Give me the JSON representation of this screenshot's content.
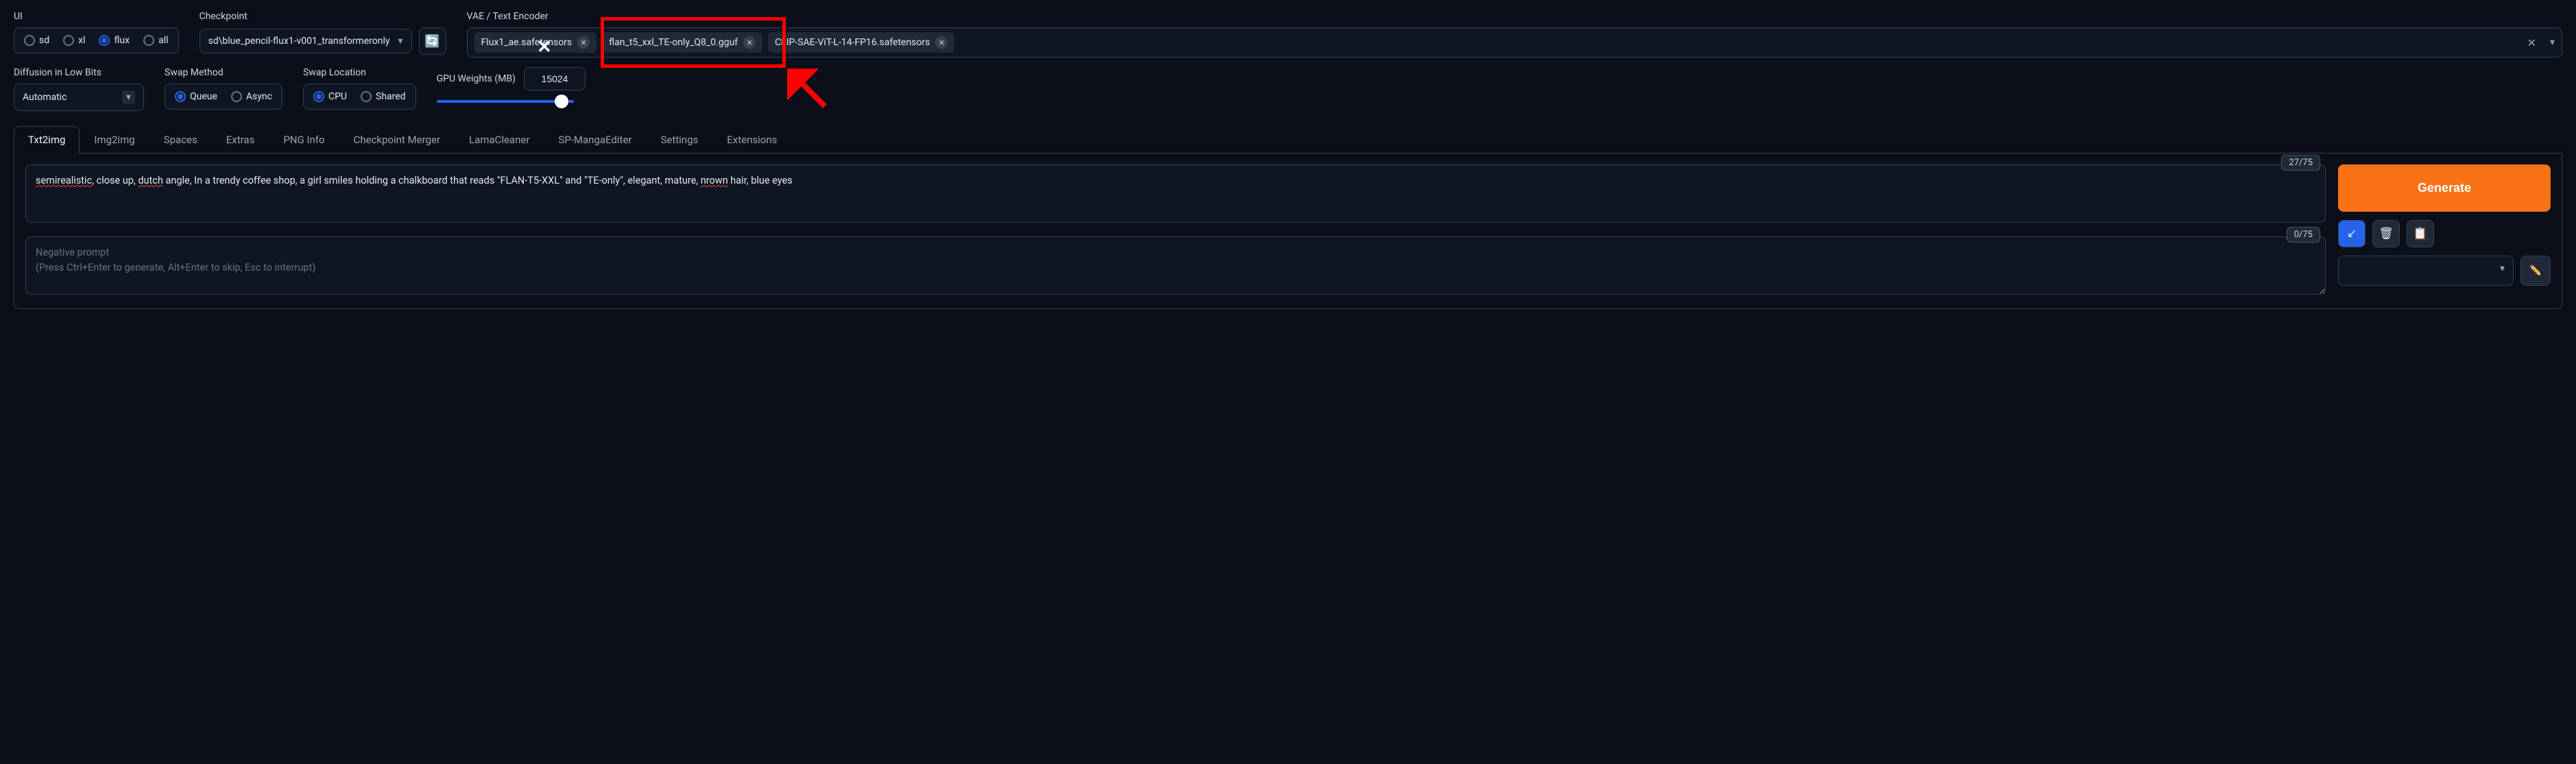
{
  "labels": {
    "ui": "UI",
    "checkpoint": "Checkpoint",
    "vae": "VAE / Text Encoder",
    "diffusion": "Diffusion in Low Bits",
    "swap_method": "Swap Method",
    "swap_location": "Swap Location",
    "gpu_weights": "GPU Weights (MB)"
  },
  "ui_options": [
    {
      "label": "sd",
      "checked": false
    },
    {
      "label": "xl",
      "checked": false
    },
    {
      "label": "flux",
      "checked": true
    },
    {
      "label": "all",
      "checked": false
    }
  ],
  "checkpoint": "sd\\blue_pencil-flux1-v001_transformeronly",
  "vae_tags": [
    "Flux1_ae.safetensors",
    "flan_t5_xxl_TE-only_Q8_0.gguf",
    "CLIP-SAE-ViT-L-14-FP16.safetensors"
  ],
  "diffusion_value": "Automatic",
  "swap_method": [
    {
      "label": "Queue",
      "checked": true
    },
    {
      "label": "Async",
      "checked": false
    }
  ],
  "swap_location": [
    {
      "label": "CPU",
      "checked": true
    },
    {
      "label": "Shared",
      "checked": false
    }
  ],
  "gpu_weights_value": "15024",
  "tabs": [
    "Txt2img",
    "Img2img",
    "Spaces",
    "Extras",
    "PNG Info",
    "Checkpoint Merger",
    "LamaCleaner",
    "SP-MangaEditer",
    "Settings",
    "Extensions"
  ],
  "active_tab": "Txt2img",
  "prompt": {
    "text": "semirealistic, close up, dutch angle, In a trendy coffee shop, a girl smiles holding a chalkboard that reads \"FLAN-T5-XXL\" and \"TE-only\", elegant, mature, nrown hair, blue eyes",
    "token_count": "27/75"
  },
  "negative_prompt": {
    "placeholder": "Negative prompt\n(Press Ctrl+Enter to generate, Alt+Enter to skip, Esc to interrupt)",
    "token_count": "0/75"
  },
  "generate_label": "Generate",
  "icons": {
    "arrow": "↙",
    "trash": "🗑",
    "clipboard": "📋",
    "pencil": "✏️"
  }
}
